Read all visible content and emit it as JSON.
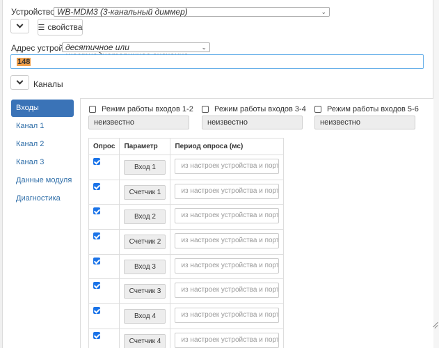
{
  "device": {
    "label": "Устройство 10",
    "selected": "WB-MDM3 (3-канальный диммер)",
    "properties_label": "свойства"
  },
  "address": {
    "label": "Адрес устройства",
    "format_selected": "десятичное или шестнадцатеричное значение",
    "value": "148"
  },
  "channels": {
    "label": "Каналы"
  },
  "nav": {
    "items": [
      {
        "label": "Входы",
        "active": true
      },
      {
        "label": "Канал 1",
        "active": false
      },
      {
        "label": "Канал 2",
        "active": false
      },
      {
        "label": "Канал 3",
        "active": false
      },
      {
        "label": "Данные модуля",
        "active": false
      },
      {
        "label": "Диагностика",
        "active": false
      }
    ]
  },
  "modes": [
    {
      "label": "Режим работы входов 1-2",
      "value": "неизвестно",
      "checked": false
    },
    {
      "label": "Режим работы входов 3-4",
      "value": "неизвестно",
      "checked": false
    },
    {
      "label": "Режим работы входов 5-6",
      "value": "неизвестно",
      "checked": false
    }
  ],
  "table": {
    "headers": [
      "Опрос",
      "Параметр",
      "Период опроса (мс)"
    ],
    "placeholder": "из настроек устройства и порта",
    "rows": [
      {
        "param": "Вход 1",
        "checked": true
      },
      {
        "param": "Счетчик 1",
        "checked": true
      },
      {
        "param": "Вход 2",
        "checked": true
      },
      {
        "param": "Счетчик 2",
        "checked": true
      },
      {
        "param": "Вход 3",
        "checked": true
      },
      {
        "param": "Счетчик 3",
        "checked": true
      },
      {
        "param": "Вход 4",
        "checked": true
      },
      {
        "param": "Счетчик 4",
        "checked": true
      }
    ]
  },
  "icons": {
    "collapse": "chevron-down-icon",
    "properties": "list-icon",
    "dropdown": "caret-down-icon",
    "checkbox": "checkbox-icon"
  },
  "colors": {
    "accent": "#3a73b7",
    "link": "#2f6ea8",
    "checkbox": "#1a73e8",
    "highlight": "#f0a04b",
    "focus": "#66afe9"
  }
}
